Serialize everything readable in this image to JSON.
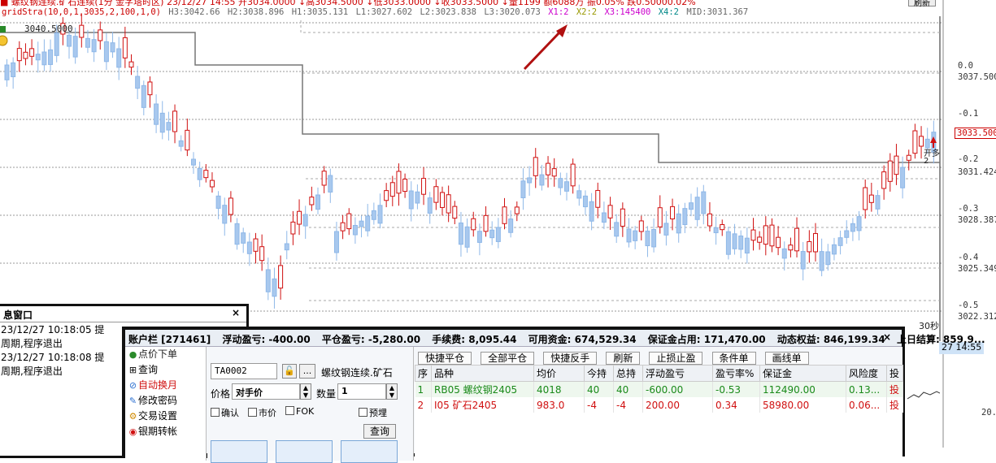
{
  "header": {
    "line1": "■ 螺纹钢连续.矿石连续(1分 金字塔时区) 23/12/27 14:55 开3034.0000 ↓高3034.5000 ↓低3033.0000 ↓收3033.5000 ↓量1199 额6088万 振0.05% 跌0.50000.02%",
    "refresh": "刷新"
  },
  "indicator": {
    "name": "gridStra(10,0,1,3035,2,100,1,0)",
    "H3": "H3:3042.66",
    "H2": "H2:3038.896",
    "H1": "H1:3035.131",
    "L1": "L1:3027.602",
    "L2": "L2:3023.838",
    "L3": "L3:3020.073",
    "X1": "X1:2",
    "X2": "X2:2",
    "X3": "X3:145400",
    "X4": "X4:2",
    "MID": "MID:3031.367",
    "colors": {
      "X1": "#cc00cc",
      "X2": "#999900",
      "X3": "#cc00cc",
      "X4": "#008888",
      "MID": "#666666"
    }
  },
  "chart": {
    "price_tag": "3040.5000",
    "axis": [
      "0.0",
      "3037.500",
      "-0.1",
      "3031.424",
      "-0.2",
      "-0.3",
      "3028.387",
      "-0.4",
      "3025.349",
      "-0.5",
      "3022.312"
    ],
    "last_price": "3033.500",
    "signal_text": "开多",
    "signal_count": "2",
    "countdown": "30秒",
    "time_box": "27 14:55",
    "right_partial": "20."
  },
  "message_window": {
    "title": "息窗口",
    "lines": [
      "23/12/27 10:18:05  提",
      "周期,程序退出",
      "23/12/27 10:18:08  提",
      "周期,程序退出"
    ]
  },
  "account": {
    "bar_items": [
      "账户栏 [271461]",
      "浮动盈亏: -400.00",
      "平仓盈亏: -5,280.00",
      "手续费: 8,095.44",
      "可用资金: 674,529.34",
      "保证金占用: 171,470.00",
      "动态权益: 846,199.34",
      "上日结算: 859,9..."
    ]
  },
  "menu": [
    {
      "icon": "●",
      "label": "点价下单",
      "color": "#2a8a2a"
    },
    {
      "icon": "⊞",
      "label": "查询",
      "color": "#222"
    },
    {
      "icon": "⊘",
      "label": "自动换月",
      "color": "#d01010"
    },
    {
      "icon": "✎",
      "label": "修改密码",
      "color": "#222"
    },
    {
      "icon": "⚙",
      "label": "交易设置",
      "color": "#222"
    },
    {
      "icon": "◉",
      "label": "银期转帐",
      "color": "#222"
    }
  ],
  "order": {
    "account_id": "TA0002",
    "instrument": "螺纹钢连续.矿石",
    "price_label": "价格",
    "price_value": "对手价",
    "qty_label": "数量",
    "qty_value": "1",
    "confirm": "确认",
    "market": "市价",
    "fok": "FOK",
    "preorder": "预埋",
    "query": "查询"
  },
  "positions": {
    "buttons": [
      "快捷平仓",
      "全部平仓",
      "快捷反手",
      "刷新",
      "止损止盈",
      "条件单",
      "画线单"
    ],
    "columns": [
      "序",
      "品种",
      "均价",
      "今持",
      "总持",
      "浮动盈亏",
      "盈亏率%",
      "保证金",
      "风险度",
      "投"
    ],
    "rows": [
      {
        "side": "buy",
        "cells": [
          "1",
          "RB05 螺纹钢2405",
          "4018",
          "40",
          "40",
          "-600.00",
          "-0.53",
          "112490.00",
          "0.13...",
          "投"
        ]
      },
      {
        "side": "sell",
        "cells": [
          "2",
          "I05 矿石2405",
          "983.0",
          "-4",
          "-4",
          "200.00",
          "0.34",
          "58980.00",
          "0.06...",
          "投"
        ]
      }
    ]
  }
}
